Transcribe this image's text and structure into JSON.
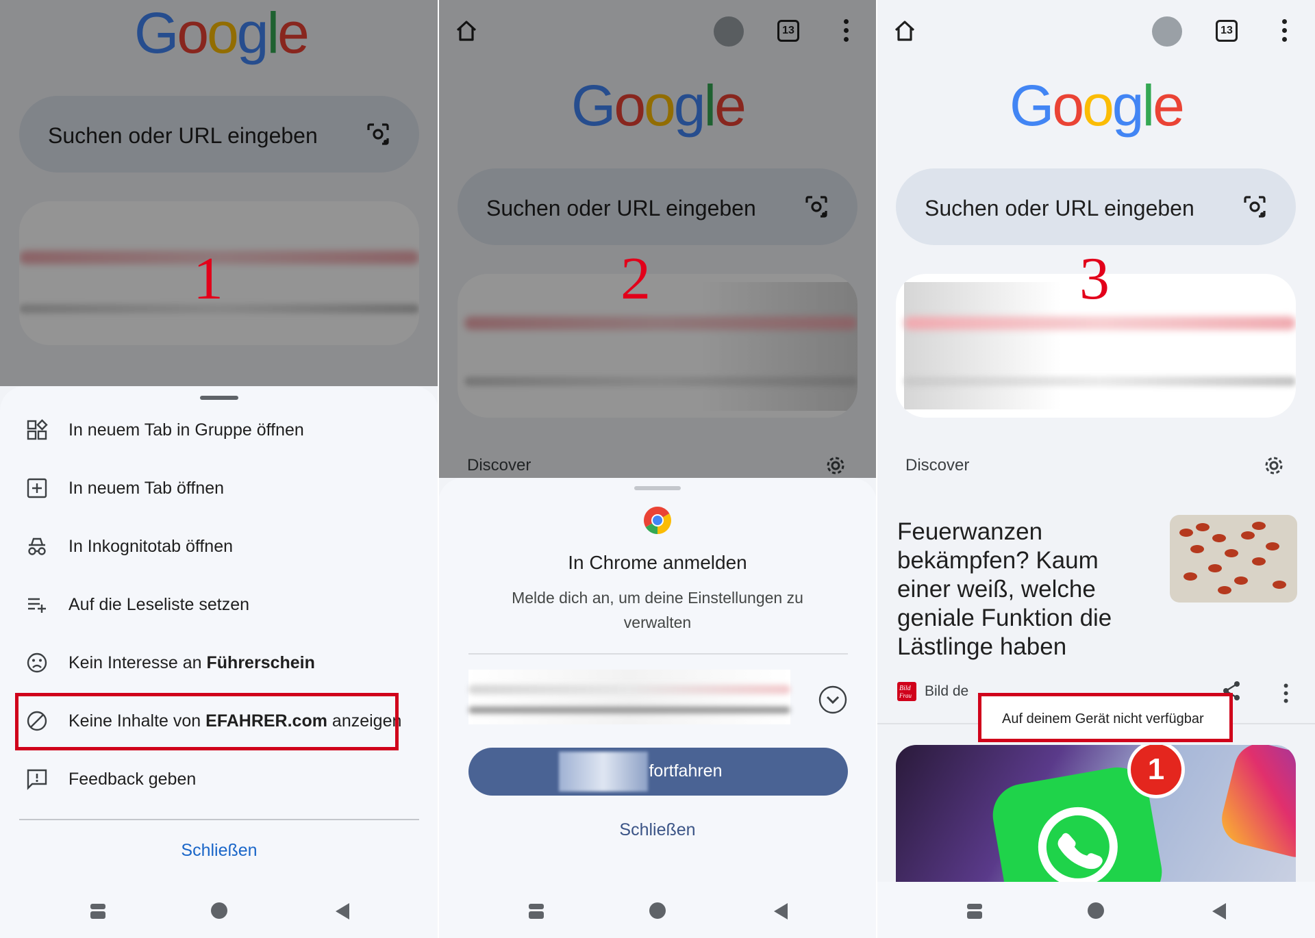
{
  "logo": {
    "letters": [
      "G",
      "o",
      "o",
      "g",
      "l",
      "e"
    ]
  },
  "search": {
    "placeholder": "Suchen oder URL eingeben"
  },
  "tab_count": "13",
  "step_numbers": [
    "1",
    "2",
    "3"
  ],
  "panel1": {
    "menu": {
      "items": [
        {
          "label": "In neuem Tab in Gruppe öffnen",
          "icon": "tab-group-icon"
        },
        {
          "label": "In neuem Tab öffnen",
          "icon": "new-tab-icon"
        },
        {
          "label": "In Inkognitotab öffnen",
          "icon": "incognito-icon"
        },
        {
          "label": "Auf die Leseliste setzen",
          "icon": "reading-list-icon"
        },
        {
          "label_prefix": "Kein Interesse an ",
          "label_bold": "Führerschein",
          "icon": "sad-face-icon"
        },
        {
          "label_prefix": "Keine Inhalte von ",
          "label_bold": "EFAHRER.com",
          "label_suffix": " anzeigen",
          "icon": "block-icon",
          "highlighted": true
        },
        {
          "label": "Feedback geben",
          "icon": "feedback-icon"
        }
      ],
      "close_label": "Schließen"
    }
  },
  "panel2": {
    "discover_label": "Discover",
    "signin": {
      "title": "In Chrome anmelden",
      "subtitle_line1": "Melde dich an, um deine Einstellungen zu",
      "subtitle_line2": "verwalten",
      "continue_label": "fortfahren",
      "close_label": "Schließen"
    }
  },
  "panel3": {
    "discover_label": "Discover",
    "article": {
      "headline_lines": [
        "Feuerwanzen",
        "bekämpfen? Kaum",
        "einer weiß, welche",
        "geniale Funktion die",
        "Lästlinge haben"
      ],
      "source_prefix": "Bild de",
      "source_logo_text": "Bild der Frau"
    },
    "tooltip": "Auf deinem Gerät nicht verfügbar",
    "whatsapp_badge": "1"
  },
  "colors": {
    "accent_red": "#d0021b",
    "link_blue": "#1a66c8",
    "button_blue": "#4a6394"
  }
}
